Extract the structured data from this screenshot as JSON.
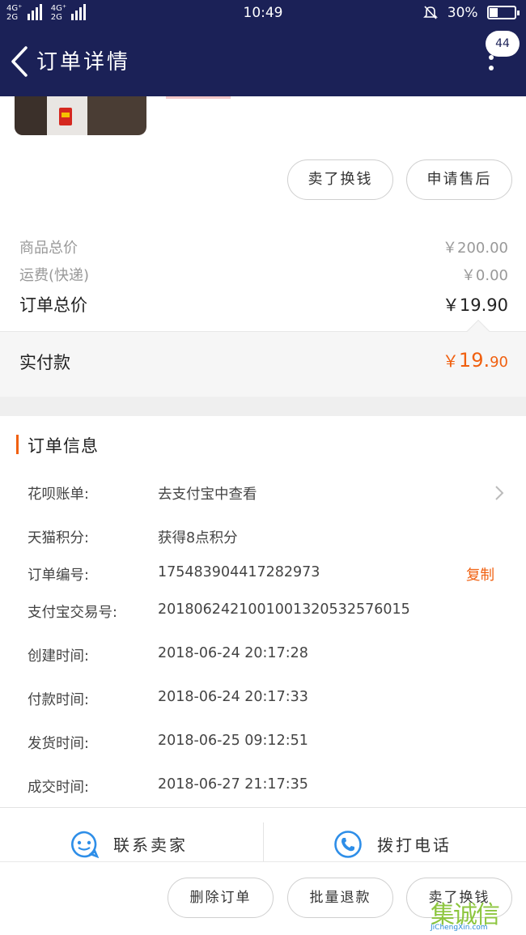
{
  "status_bar": {
    "network_1": "4G⁺",
    "network_2": "4G⁺",
    "network_3": "2G",
    "network_2b": "2G",
    "time": "10:49",
    "battery": "30%"
  },
  "header": {
    "title": "订单详情",
    "badge_count": "44"
  },
  "product_actions": {
    "sell_label": "卖了换钱",
    "after_sale_label": "申请售后"
  },
  "pricing": {
    "goods_total_label": "商品总价",
    "goods_total_value": "￥200.00",
    "shipping_label": "运费(快递)",
    "shipping_value": "￥0.00",
    "order_total_label": "订单总价",
    "order_total_value": "￥19.90",
    "paid_label": "实付款",
    "paid_currency": "￥",
    "paid_integer": "19.",
    "paid_decimal": "90",
    "accent_color": "#f06010"
  },
  "order_info": {
    "section_title": "订单信息",
    "rows": [
      {
        "key": "花呗账单:",
        "value": "去支付宝中查看"
      },
      {
        "key": "天猫积分:",
        "value": "获得8点积分"
      },
      {
        "key": "订单编号:",
        "value": "175483904417282973"
      },
      {
        "key": "支付宝交易号:",
        "value": "2018062421001001320532576015"
      },
      {
        "key": "创建时间:",
        "value": "2018-06-24 20:17:28"
      },
      {
        "key": "付款时间:",
        "value": "2018-06-24 20:17:33"
      },
      {
        "key": "发货时间:",
        "value": "2018-06-25 09:12:51"
      },
      {
        "key": "成交时间:",
        "value": "2018-06-27 21:17:35"
      }
    ],
    "copy_label": "复制"
  },
  "contact": {
    "seller_label": "联系卖家",
    "phone_label": "拨打电话",
    "icon_color": "#2e8ee8"
  },
  "bottom_actions": {
    "delete_label": "删除订单",
    "refund_label": "批量退款",
    "sell_label": "卖了换钱"
  },
  "watermark": {
    "logo": "集诚信",
    "url": "JiChengXin.com"
  },
  "colors": {
    "header_bg": "#1b2157"
  }
}
